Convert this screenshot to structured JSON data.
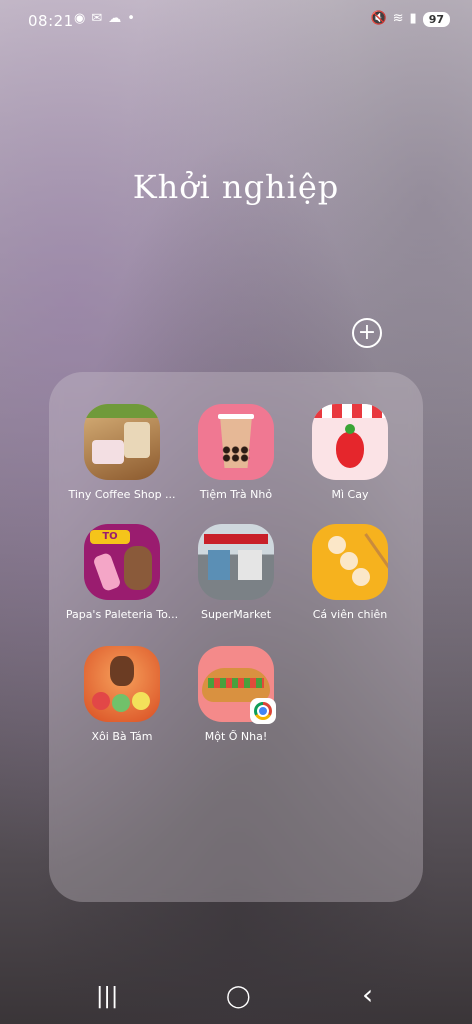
{
  "status": {
    "time": "08:21",
    "left_icons": [
      "chrome-notif-icon",
      "message-icon",
      "cloud-icon",
      "dot-icon"
    ],
    "right_icons": [
      "mute-icon",
      "wifi-icon",
      "signal-icon"
    ],
    "battery": "97"
  },
  "folder": {
    "title": "Khởi nghiệp",
    "apps": [
      {
        "label": "Tiny Coffee Shop ...",
        "icon": "coffee-shop-icon"
      },
      {
        "label": "Tiệm Trà Nhỏ",
        "icon": "bubble-tea-icon"
      },
      {
        "label": "Mì Cay",
        "icon": "chili-icon"
      },
      {
        "label": "Papa's Paleteria To...",
        "icon": "papas-paleteria-icon"
      },
      {
        "label": "SuperMarket",
        "icon": "supermarket-icon"
      },
      {
        "label": "Cá viên chiên",
        "icon": "fishball-icon"
      },
      {
        "label": "Xôi Bà Tám",
        "icon": "xoi-icon"
      },
      {
        "label": "Một Ổ Nha!",
        "icon": "banh-mi-icon"
      }
    ]
  },
  "nav": {
    "recents": "|||",
    "home": "◯",
    "back": "‹"
  }
}
